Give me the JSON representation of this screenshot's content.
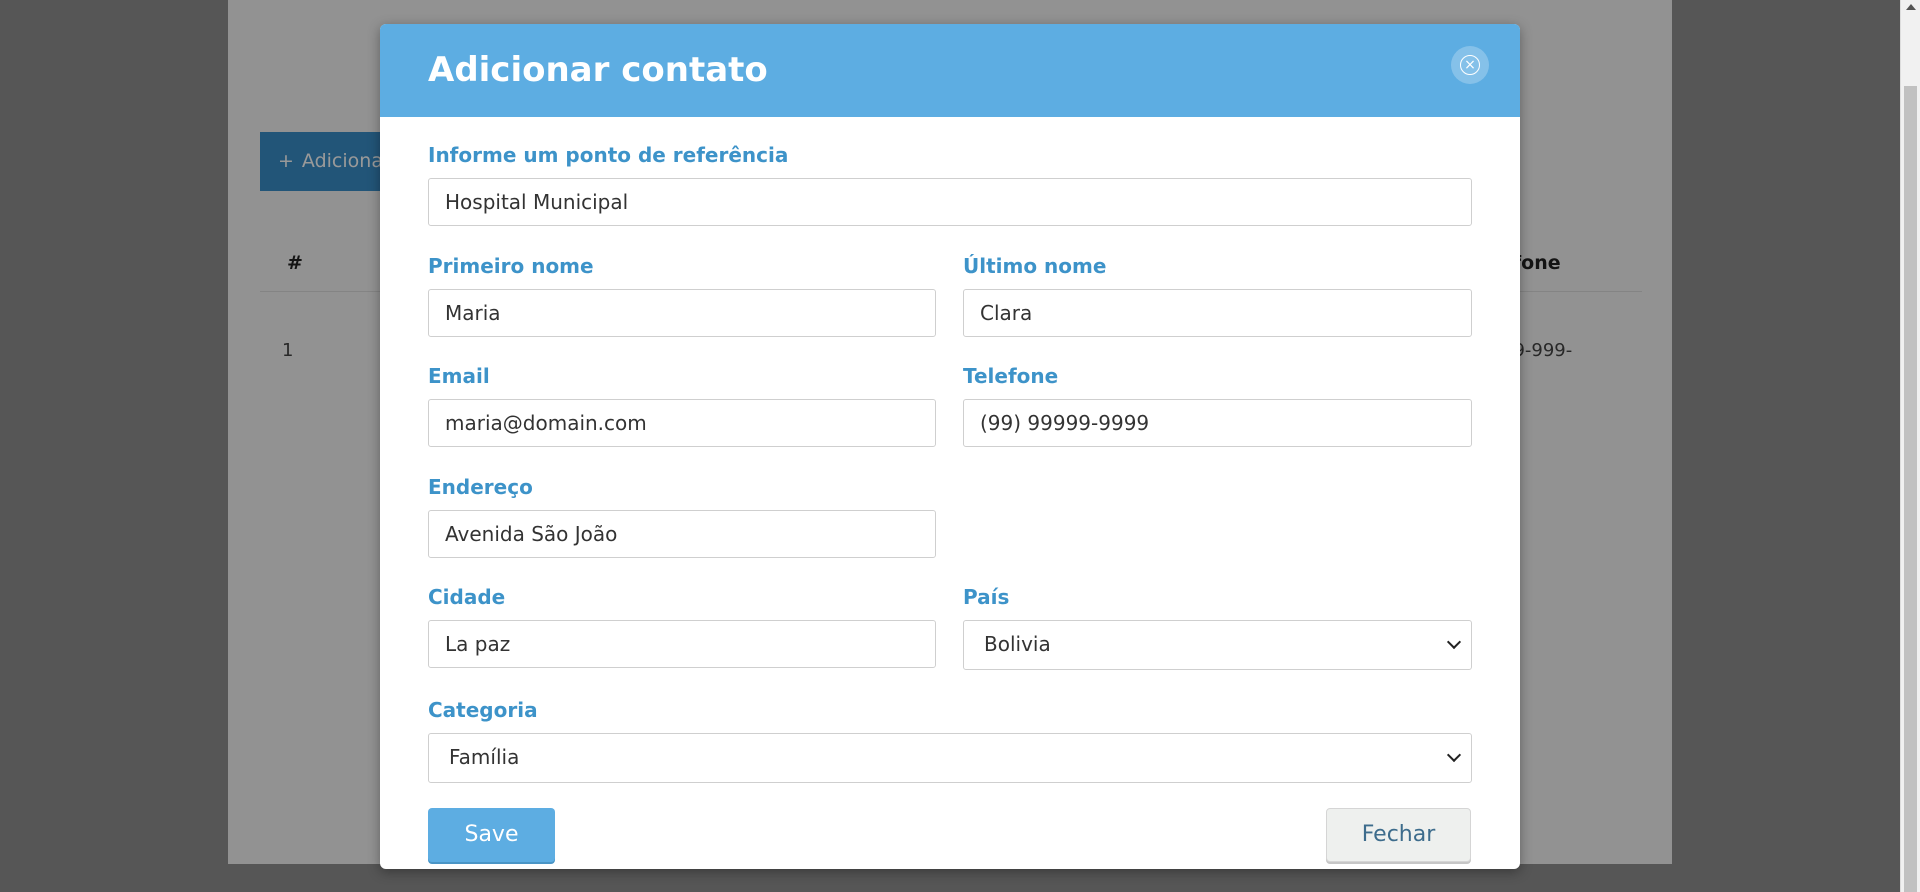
{
  "background": {
    "add_button_label": "Adiciona",
    "add_button_icon": "+",
    "table_header_hash": "#",
    "table_header_phone": "efone",
    "row_1_index": "1",
    "row_1_phone": "99-999-"
  },
  "modal": {
    "title": "Adicionar contato",
    "close_icon": "close-circle-icon",
    "fields": {
      "reference": {
        "label": "Informe um ponto de referência",
        "value": "Hospital Municipal"
      },
      "first_name": {
        "label": "Primeiro nome",
        "value": "Maria"
      },
      "last_name": {
        "label": "Último nome",
        "value": "Clara"
      },
      "email": {
        "label": "Email",
        "value": "maria@domain.com"
      },
      "phone": {
        "label": "Telefone",
        "value": "(99) 99999-9999"
      },
      "address": {
        "label": "Endereço",
        "value": "Avenida São João"
      },
      "city": {
        "label": "Cidade",
        "value": "La paz"
      },
      "country": {
        "label": "País",
        "value": "Bolivia"
      },
      "category": {
        "label": "Categoria",
        "value": "Família"
      }
    },
    "save_label": "Save",
    "close_label": "Fechar"
  },
  "colors": {
    "header_bg": "#5dade2",
    "label": "#3d93c9",
    "primary_button": "#5dade2"
  }
}
